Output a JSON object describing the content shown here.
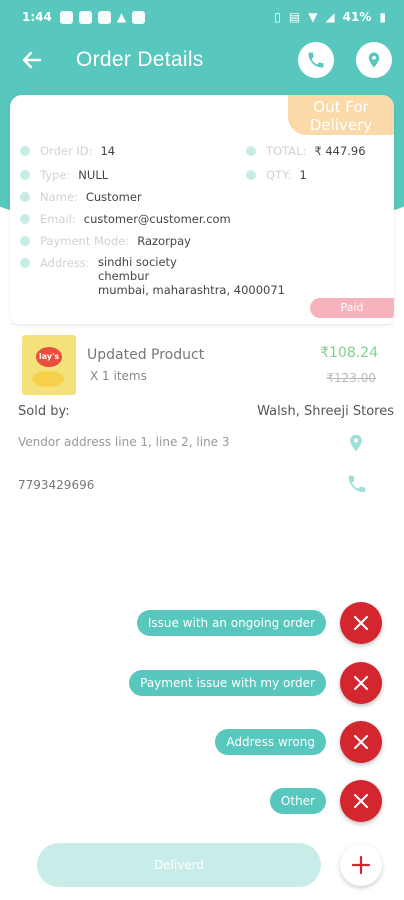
{
  "statusbar": {
    "time": "1:44",
    "battery": "41%"
  },
  "header": {
    "title": "Order Details"
  },
  "order": {
    "status": "Out For Delivery",
    "order_id_label": "Order ID:",
    "order_id": "14",
    "type_label": "Type:",
    "type": "NULL",
    "name_label": "Name:",
    "name": "Customer",
    "email_label": "Email:",
    "email": "customer@customer.com",
    "payment_label": "Payment Mode:",
    "payment": "Razorpay",
    "address_label": "Address:",
    "address_line1": "sindhi society",
    "address_line2": "chembur",
    "address_line3": "mumbai, maharashtra, 4000071",
    "total_label": "TOTAL:",
    "total": "₹ 447.96",
    "qty_label": "QTY:",
    "qty": "1",
    "payment_status": "Paid"
  },
  "product": {
    "name": "Updated Product",
    "qty": "X 1 items",
    "price": "₹108.24",
    "old_price": "₹123.00"
  },
  "vendor": {
    "sold_by_label": "Sold by:",
    "store": "Walsh, Shreeji Stores",
    "address": "Vendor address line 1, line 2, line 3",
    "phone": "7793429696"
  },
  "menu": {
    "items": [
      {
        "label": "Issue with an ongoing order"
      },
      {
        "label": "Payment issue with my order"
      },
      {
        "label": "Address wrong"
      },
      {
        "label": "Other"
      }
    ]
  },
  "footer": {
    "delivered_label": "Deliverd"
  },
  "colors": {
    "accent": "#58c7bd",
    "danger": "#d3262f",
    "price": "#7bd38f"
  }
}
